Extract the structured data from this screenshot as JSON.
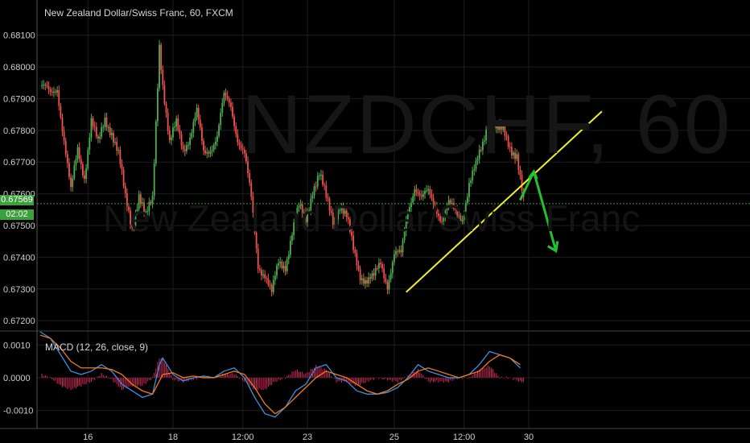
{
  "title": "New Zealand Dollar/Swiss Franc, 60, FXCM",
  "watermark": {
    "symbol": "NZDCHF, 60",
    "name": "New Zealand Dollar/Swiss Franc"
  },
  "current_price": "0.67569",
  "countdown": "02:02",
  "macd_label": "MACD (12, 26, close, 9)",
  "colors": {
    "up": "#4caf50",
    "down": "#ef5350",
    "trendline": "#f0f026",
    "arrow": "#22c22e",
    "macd": "#3d8fe0",
    "signal": "#f07a1a",
    "hist": "#e0245e",
    "grid": "#1c1c1c"
  },
  "chart_data": [
    {
      "type": "candlestick",
      "title": "New Zealand Dollar/Swiss Franc, 60, FXCM",
      "x_ticks": [
        "16",
        "18",
        "12:00",
        "23",
        "25",
        "12:00",
        "30"
      ],
      "y_ticks": [
        "0.68100",
        "0.68000",
        "0.67900",
        "0.67800",
        "0.67700",
        "0.67600",
        "0.67500",
        "0.67400",
        "0.67300",
        "0.67200"
      ],
      "ylim": [
        0.6717,
        0.6815
      ],
      "xlim": [
        0,
        400
      ],
      "grid": true,
      "series_close": [
        [
          0,
          0.6794
        ],
        [
          6,
          0.6791
        ],
        [
          10,
          0.6794
        ],
        [
          14,
          0.6777
        ],
        [
          18,
          0.676
        ],
        [
          22,
          0.6774
        ],
        [
          26,
          0.6766
        ],
        [
          30,
          0.6783
        ],
        [
          34,
          0.6775
        ],
        [
          38,
          0.6784
        ],
        [
          42,
          0.678
        ],
        [
          46,
          0.6772
        ],
        [
          50,
          0.6758
        ],
        [
          54,
          0.675
        ],
        [
          58,
          0.676
        ],
        [
          62,
          0.6752
        ],
        [
          66,
          0.6758
        ],
        [
          70,
          0.6808
        ],
        [
          72,
          0.6795
        ],
        [
          76,
          0.6775
        ],
        [
          80,
          0.6782
        ],
        [
          84,
          0.6775
        ],
        [
          88,
          0.6778
        ],
        [
          92,
          0.6785
        ],
        [
          96,
          0.6773
        ],
        [
          100,
          0.6775
        ],
        [
          104,
          0.6778
        ],
        [
          108,
          0.679
        ],
        [
          112,
          0.6788
        ],
        [
          116,
          0.6778
        ],
        [
          120,
          0.6772
        ],
        [
          124,
          0.6758
        ],
        [
          128,
          0.6738
        ],
        [
          132,
          0.6735
        ],
        [
          136,
          0.6728
        ],
        [
          140,
          0.6738
        ],
        [
          144,
          0.6738
        ],
        [
          148,
          0.6748
        ],
        [
          152,
          0.6755
        ],
        [
          156,
          0.6752
        ],
        [
          160,
          0.6762
        ],
        [
          164,
          0.6766
        ],
        [
          168,
          0.6758
        ],
        [
          172,
          0.6752
        ],
        [
          176,
          0.6757
        ],
        [
          180,
          0.6752
        ],
        [
          184,
          0.6742
        ],
        [
          188,
          0.6735
        ],
        [
          192,
          0.6733
        ],
        [
          196,
          0.6733
        ],
        [
          200,
          0.6738
        ],
        [
          204,
          0.6732
        ],
        [
          208,
          0.6741
        ],
        [
          212,
          0.674
        ],
        [
          216,
          0.6755
        ],
        [
          220,
          0.6763
        ],
        [
          224,
          0.6758
        ],
        [
          228,
          0.676
        ],
        [
          232,
          0.6757
        ],
        [
          236,
          0.6752
        ],
        [
          240,
          0.6756
        ],
        [
          244,
          0.6754
        ],
        [
          248,
          0.6753
        ],
        [
          252,
          0.6763
        ],
        [
          256,
          0.6768
        ],
        [
          260,
          0.6776
        ],
        [
          264,
          0.6786
        ],
        [
          268,
          0.678
        ],
        [
          272,
          0.6779
        ],
        [
          276,
          0.6775
        ],
        [
          280,
          0.6773
        ],
        [
          284,
          0.6757
        ]
      ],
      "trendline": {
        "from": [
          215,
          0.6729
        ],
        "to": [
          330,
          0.6786
        ]
      },
      "arrow": [
        [
          282,
          0.6758
        ],
        [
          290,
          0.6767
        ],
        [
          303,
          0.6742
        ]
      ]
    },
    {
      "type": "line",
      "title": "MACD (12, 26, close, 9)",
      "y_ticks": [
        "0.0010",
        "0.0000",
        "-0.0010"
      ],
      "ylim": [
        -0.00155,
        0.0014
      ],
      "series": [
        {
          "values": [
            [
              0,
              0.0014
            ],
            [
              6,
              0.0012
            ],
            [
              12,
              0.0007
            ],
            [
              18,
              0.0002
            ],
            [
              24,
              0.0001
            ],
            [
              30,
              0.0002
            ],
            [
              36,
              0.0004
            ],
            [
              42,
              0.0002
            ],
            [
              48,
              -0.0002
            ],
            [
              54,
              -0.0004
            ],
            [
              60,
              -0.0006
            ],
            [
              66,
              -0.0005
            ],
            [
              70,
              0.0004
            ],
            [
              72,
              0.0006
            ],
            [
              78,
              0.0001
            ],
            [
              84,
              -0.0001
            ],
            [
              90,
              0.0
            ],
            [
              96,
              5e-05
            ],
            [
              102,
              0.0
            ],
            [
              108,
              0.0002
            ],
            [
              114,
              0.0003
            ],
            [
              120,
              0.0
            ],
            [
              126,
              -0.0006
            ],
            [
              132,
              -0.0011
            ],
            [
              138,
              -0.0012
            ],
            [
              144,
              -0.0009
            ],
            [
              150,
              -0.0004
            ],
            [
              156,
              -0.0002
            ],
            [
              162,
              0.0003
            ],
            [
              168,
              0.0004
            ],
            [
              174,
              0.0
            ],
            [
              180,
              -0.0001
            ],
            [
              186,
              -0.0004
            ],
            [
              192,
              -0.0005
            ],
            [
              198,
              -0.0005
            ],
            [
              204,
              -0.00045
            ],
            [
              210,
              -0.0003
            ],
            [
              216,
              0.0
            ],
            [
              222,
              0.0004
            ],
            [
              228,
              0.0002
            ],
            [
              234,
              0.0001
            ],
            [
              240,
              0.0
            ],
            [
              246,
              0.0
            ],
            [
              252,
              0.0001
            ],
            [
              258,
              0.0004
            ],
            [
              264,
              0.0008
            ],
            [
              270,
              0.0007
            ],
            [
              276,
              0.0006
            ],
            [
              282,
              0.0003
            ]
          ]
        },
        {
          "values": [
            [
              0,
              0.0013
            ],
            [
              6,
              0.0012
            ],
            [
              12,
              0.0009
            ],
            [
              18,
              0.0005
            ],
            [
              24,
              0.0003
            ],
            [
              30,
              0.0003
            ],
            [
              36,
              0.0003
            ],
            [
              42,
              0.00025
            ],
            [
              48,
              0.0001
            ],
            [
              54,
              -0.0002
            ],
            [
              60,
              -0.0004
            ],
            [
              66,
              -0.0005
            ],
            [
              70,
              -0.0001
            ],
            [
              72,
              0.0001
            ],
            [
              78,
              0.00015
            ],
            [
              84,
              0.0
            ],
            [
              90,
              5e-05
            ],
            [
              96,
              0.0
            ],
            [
              102,
              0.0
            ],
            [
              108,
              0.0001
            ],
            [
              114,
              0.0002
            ],
            [
              120,
              0.0001
            ],
            [
              126,
              -0.0003
            ],
            [
              132,
              -0.0008
            ],
            [
              138,
              -0.0011
            ],
            [
              144,
              -0.0009
            ],
            [
              150,
              -0.0006
            ],
            [
              156,
              -0.0003
            ],
            [
              162,
              0.0
            ],
            [
              168,
              0.0002
            ],
            [
              174,
              0.0001
            ],
            [
              180,
              0.0
            ],
            [
              186,
              -0.0002
            ],
            [
              192,
              -0.0004
            ],
            [
              198,
              -0.0005
            ],
            [
              204,
              -0.0004
            ],
            [
              210,
              -0.0002
            ],
            [
              216,
              -5e-05
            ],
            [
              222,
              0.0002
            ],
            [
              228,
              0.0003
            ],
            [
              234,
              0.0002
            ],
            [
              240,
              0.0001
            ],
            [
              246,
              0.0
            ],
            [
              252,
              0.0001
            ],
            [
              258,
              0.0002
            ],
            [
              264,
              0.0005
            ],
            [
              270,
              0.0007
            ],
            [
              276,
              0.0006
            ],
            [
              282,
              0.0004
            ]
          ]
        }
      ]
    }
  ]
}
